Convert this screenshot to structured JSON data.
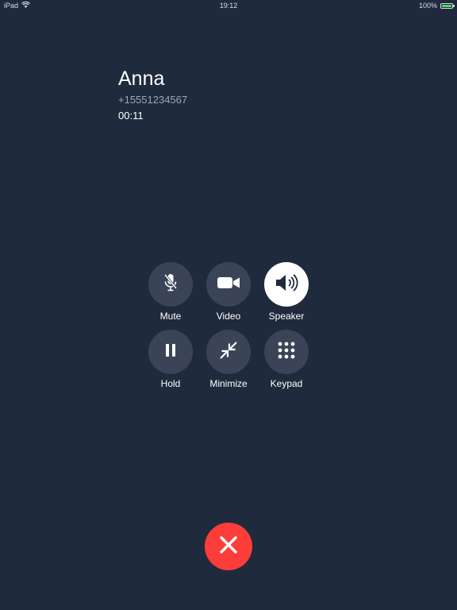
{
  "status_bar": {
    "device": "iPad",
    "time": "19:12",
    "battery": "100%",
    "battery_level": 1.0,
    "battery_color": "#4cd964"
  },
  "caller": {
    "name": "Anna",
    "number": "+15551234567",
    "duration": "00:11"
  },
  "controls": [
    {
      "id": "mute",
      "label": "Mute",
      "icon": "microphone-muted-icon",
      "active": false
    },
    {
      "id": "video",
      "label": "Video",
      "icon": "video-camera-icon",
      "active": false
    },
    {
      "id": "speaker",
      "label": "Speaker",
      "icon": "speaker-icon",
      "active": true
    },
    {
      "id": "hold",
      "label": "Hold",
      "icon": "pause-icon",
      "active": false
    },
    {
      "id": "minimize",
      "label": "Minimize",
      "icon": "minimize-arrows-icon",
      "active": false
    },
    {
      "id": "keypad",
      "label": "Keypad",
      "icon": "keypad-icon",
      "active": false
    }
  ],
  "end_call": {
    "icon": "close-x-icon",
    "color": "#fc3d39"
  },
  "colors": {
    "background": "#1f2a3c",
    "button": "#3a4456",
    "button_active": "#ffffff"
  }
}
